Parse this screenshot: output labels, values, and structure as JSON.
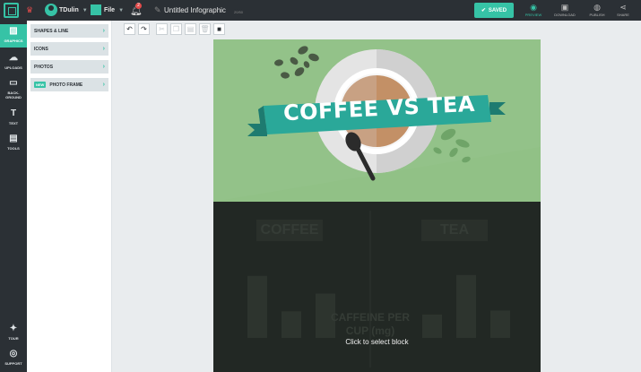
{
  "topbar": {
    "user_name": "TDulin",
    "file_label": "File",
    "notification_count": "2",
    "doc_title": "Untitled Infographic",
    "char_count": "20/50",
    "saved_label": "SAVED",
    "actions": [
      {
        "label": "PREVIEW",
        "icon": "eye-icon"
      },
      {
        "label": "DOWNLOAD",
        "icon": "download-icon"
      },
      {
        "label": "PUBLISH",
        "icon": "globe-icon"
      },
      {
        "label": "SHARE",
        "icon": "share-icon"
      }
    ]
  },
  "rail": {
    "items": [
      {
        "label": "GRAPHICS",
        "icon": "image-icon"
      },
      {
        "label": "UPLOADS",
        "icon": "cloud-upload-icon"
      },
      {
        "label": "BACK-\nGROUND",
        "icon": "monitor-icon"
      },
      {
        "label": "TEXT",
        "icon": "text-icon"
      },
      {
        "label": "TOOLS",
        "icon": "tools-icon"
      }
    ],
    "bottom": [
      {
        "label": "TOUR",
        "icon": "compass-icon"
      },
      {
        "label": "SUPPORT",
        "icon": "lifebuoy-icon"
      }
    ]
  },
  "submenu": {
    "items": [
      {
        "label": "SHAPES & LINE"
      },
      {
        "label": "ICONS"
      },
      {
        "label": "PHOTOS"
      },
      {
        "label": "PHOTO FRAME",
        "badge": "NEW"
      }
    ]
  },
  "infographic": {
    "banner_title": "COFFEE VS TEA",
    "coffee_label": "COFFEE",
    "tea_label": "TEA",
    "caffeine_label_line1": "CAFFEINE PER",
    "caffeine_label_line2": "CUP (mg)",
    "click_hint": "Click to select block",
    "coffee_bars": [
      0.77,
      0.33,
      0.55
    ],
    "tea_bars": [
      0.29,
      0.78,
      0.34
    ]
  },
  "colors": {
    "accent": "#36c3a6",
    "topbar": "#2b3035",
    "banner": "#2aa899",
    "top_block": "#91c186",
    "bottom_block": "#222824"
  }
}
